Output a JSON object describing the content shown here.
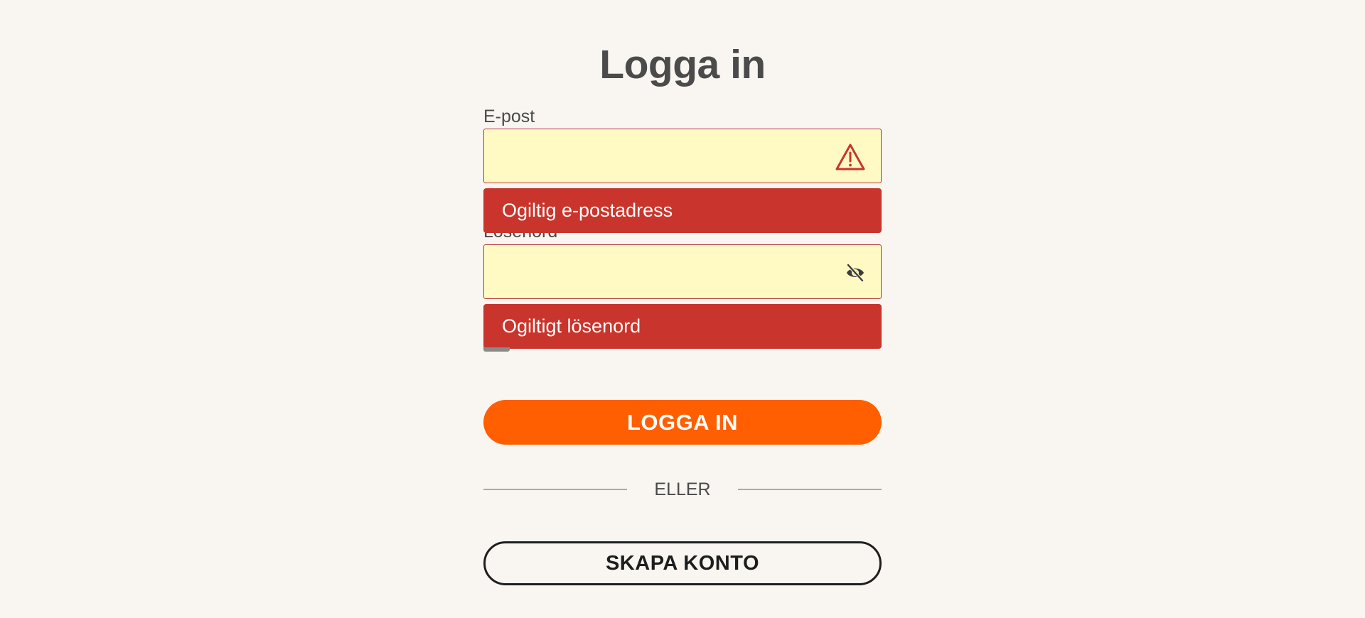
{
  "page": {
    "title": "Logga in"
  },
  "form": {
    "email": {
      "label": "E-post",
      "value": "",
      "placeholder": "",
      "status_icon": "warning-triangle-icon",
      "error": "Ogiltig e-postadress"
    },
    "password": {
      "label": "Lösenord",
      "value": "",
      "placeholder": "",
      "toggle_icon": "eye-slash-icon",
      "error": "Ogiltigt lösenord"
    },
    "login_label": "LOGGA IN",
    "divider_text": "ELLER",
    "signup_label": "SKAPA KONTO"
  },
  "colors": {
    "background": "#f9f6f1",
    "input_background": "#fffac3",
    "error_red": "#c9352c",
    "primary_orange": "#ff5f00",
    "text_dark": "#4b4b4b"
  }
}
